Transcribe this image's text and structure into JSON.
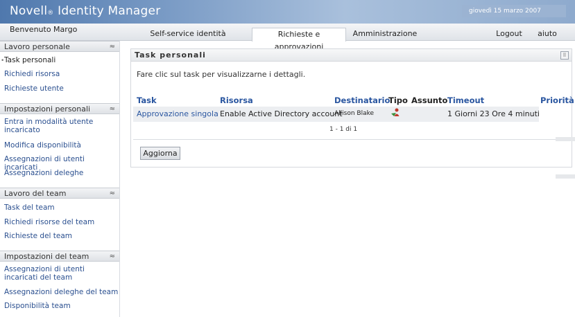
{
  "header": {
    "brand": "Novell",
    "brand_reg": "®",
    "product": "Identity Manager",
    "date": "giovedì 15 marzo 2007"
  },
  "welcome": "Benvenuto Margo",
  "tabs": [
    {
      "label": "Self-service identità"
    },
    {
      "label": "Richieste e approvazioni"
    },
    {
      "label": "Amministrazione"
    },
    {
      "label": "Logout"
    },
    {
      "label": "aiuto"
    }
  ],
  "sidebar": {
    "collapse_glyph": "≈",
    "sections": [
      {
        "title": "Lavoro personale",
        "items": [
          "Task personali",
          "Richiedi risorsa",
          "Richieste utente"
        ]
      },
      {
        "title": "Impostazioni personali",
        "items": [
          "Entra in modalità utente incaricato",
          "Modifica disponibilità",
          "Assegnazioni di utenti incaricati",
          "Assegnazioni deleghe"
        ]
      },
      {
        "title": "Lavoro del team",
        "items": [
          "Task del team",
          "Richiedi risorse del team",
          "Richieste del team"
        ]
      },
      {
        "title": "Impostazioni del team",
        "items": [
          "Assegnazioni di utenti incaricati del team",
          "Assegnazioni deleghe del team",
          "Disponibilità team"
        ]
      }
    ]
  },
  "panel": {
    "title": "Task personali",
    "icon": "⠿",
    "instruction": "Fare clic sul task per visualizzarne i dettagli.",
    "columns": [
      "Task",
      "Risorsa",
      "Destinatario",
      "Tipo",
      "Assunto",
      "Timeout",
      "Priorità"
    ],
    "rows": [
      {
        "task": "Approvazione singola",
        "resource": "Enable Active Directory account",
        "recipient": "Allison Blake",
        "type_icon": "person-approval-icon",
        "assigned": "",
        "timeout": "1 Giorni 23 Ore 4 minuti",
        "priority": ""
      }
    ],
    "pager": "1 - 1 di 1",
    "refresh_button": "Aggiorna"
  }
}
